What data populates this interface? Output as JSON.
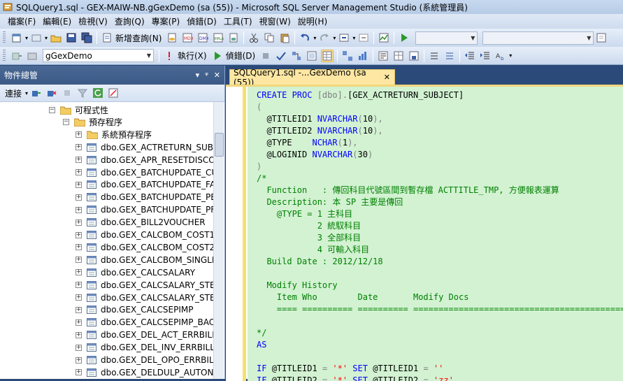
{
  "window": {
    "title": "SQLQuery1.sql - GEX-MAIW-NB.gGexDemo (sa (55)) - Microsoft SQL Server Management Studio (系統管理員)"
  },
  "menu": [
    "檔案(F)",
    "編輯(E)",
    "檢視(V)",
    "查詢(Q)",
    "專案(P)",
    "偵錯(D)",
    "工具(T)",
    "視窗(W)",
    "說明(H)"
  ],
  "toolbar1": {
    "new_query": "新增查詢(N)",
    "combo1": "",
    "combo2": ""
  },
  "toolbar2": {
    "database": "gGexDemo",
    "execute": "執行(X)",
    "debug": "偵錯(D)"
  },
  "object_explorer": {
    "title": "物件總管",
    "connect": "連接",
    "tree": [
      {
        "label": "可程式性",
        "level": 0,
        "state": "expanded",
        "kind": "folder"
      },
      {
        "label": "預存程序",
        "level": 1,
        "state": "expanded",
        "kind": "folder"
      },
      {
        "label": "系統預存程序",
        "level": 2,
        "state": "collapsed",
        "kind": "folder"
      },
      {
        "label": "dbo.GEX_ACTRETURN_SUB.",
        "level": 2,
        "state": "collapsed",
        "kind": "sp"
      },
      {
        "label": "dbo.GEX_APR_RESETDISCO",
        "level": 2,
        "state": "collapsed",
        "kind": "sp"
      },
      {
        "label": "dbo.GEX_BATCHUPDATE_CU",
        "level": 2,
        "state": "collapsed",
        "kind": "sp"
      },
      {
        "label": "dbo.GEX_BATCHUPDATE_FA",
        "level": 2,
        "state": "collapsed",
        "kind": "sp"
      },
      {
        "label": "dbo.GEX_BATCHUPDATE_PE",
        "level": 2,
        "state": "collapsed",
        "kind": "sp"
      },
      {
        "label": "dbo.GEX_BATCHUPDATE_PF",
        "level": 2,
        "state": "collapsed",
        "kind": "sp"
      },
      {
        "label": "dbo.GEX_BILL2VOUCHER",
        "level": 2,
        "state": "collapsed",
        "kind": "sp"
      },
      {
        "label": "dbo.GEX_CALCBOM_COST1",
        "level": 2,
        "state": "collapsed",
        "kind": "sp"
      },
      {
        "label": "dbo.GEX_CALCBOM_COST2",
        "level": 2,
        "state": "collapsed",
        "kind": "sp"
      },
      {
        "label": "dbo.GEX_CALCBOM_SINGLE",
        "level": 2,
        "state": "collapsed",
        "kind": "sp"
      },
      {
        "label": "dbo.GEX_CALCSALARY",
        "level": 2,
        "state": "collapsed",
        "kind": "sp"
      },
      {
        "label": "dbo.GEX_CALCSALARY_STEI",
        "level": 2,
        "state": "collapsed",
        "kind": "sp"
      },
      {
        "label": "dbo.GEX_CALCSALARY_STEI",
        "level": 2,
        "state": "collapsed",
        "kind": "sp"
      },
      {
        "label": "dbo.GEX_CALCSEPIMP",
        "level": 2,
        "state": "collapsed",
        "kind": "sp"
      },
      {
        "label": "dbo.GEX_CALCSEPIMP_BAC",
        "level": 2,
        "state": "collapsed",
        "kind": "sp"
      },
      {
        "label": "dbo.GEX_DEL_ACT_ERRBILL",
        "level": 2,
        "state": "collapsed",
        "kind": "sp"
      },
      {
        "label": "dbo.GEX_DEL_INV_ERRBILL",
        "level": 2,
        "state": "collapsed",
        "kind": "sp"
      },
      {
        "label": "dbo.GEX_DEL_OPO_ERRBILL",
        "level": 2,
        "state": "collapsed",
        "kind": "sp"
      },
      {
        "label": "dbo.GEX_DELDULP_AUTON",
        "level": 2,
        "state": "collapsed",
        "kind": "sp"
      }
    ]
  },
  "editor": {
    "tab_title": "SQLQuery1.sql -...GexDemo (sa (55))",
    "lines": [
      [
        {
          "t": "CREATE PROC ",
          "c": "kw"
        },
        {
          "t": "[dbo]",
          "c": "gy"
        },
        {
          "t": ".",
          "c": "gy"
        },
        {
          "t": "[GEX_ACTRETURN_SUBJECT]",
          "c": ""
        }
      ],
      [
        {
          "t": "(",
          "c": "gy"
        }
      ],
      [
        {
          "t": "  @TITLEID1 ",
          "c": ""
        },
        {
          "t": "NVARCHAR",
          "c": "kw"
        },
        {
          "t": "(",
          "c": "gy"
        },
        {
          "t": "10",
          "c": ""
        },
        {
          "t": "),",
          "c": "gy"
        }
      ],
      [
        {
          "t": "  @TITLEID2 ",
          "c": ""
        },
        {
          "t": "NVARCHAR",
          "c": "kw"
        },
        {
          "t": "(",
          "c": "gy"
        },
        {
          "t": "10",
          "c": ""
        },
        {
          "t": "),",
          "c": "gy"
        }
      ],
      [
        {
          "t": "  @TYPE    ",
          "c": ""
        },
        {
          "t": "NCHAR",
          "c": "kw"
        },
        {
          "t": "(",
          "c": "gy"
        },
        {
          "t": "1",
          "c": ""
        },
        {
          "t": "),",
          "c": "gy"
        }
      ],
      [
        {
          "t": "  @LOGINID ",
          "c": ""
        },
        {
          "t": "NVARCHAR",
          "c": "kw"
        },
        {
          "t": "(",
          "c": "gy"
        },
        {
          "t": "30",
          "c": ""
        },
        {
          "t": ")",
          "c": "gy"
        }
      ],
      [
        {
          "t": ")",
          "c": "gy"
        }
      ],
      [
        {
          "t": "/*",
          "c": "cm"
        }
      ],
      [
        {
          "t": "  Function   : 傳回科目代號區間到暫存檔 ACTTITLE_TMP, 方便報表運算",
          "c": "cm"
        }
      ],
      [
        {
          "t": "  Description: 本 SP 主要是傳回",
          "c": "cm"
        }
      ],
      [
        {
          "t": "    @TYPE = 1 主科目",
          "c": "cm"
        }
      ],
      [
        {
          "t": "            2 統馭科目",
          "c": "cm"
        }
      ],
      [
        {
          "t": "            3 全部科目",
          "c": "cm"
        }
      ],
      [
        {
          "t": "            4 可輸入科目",
          "c": "cm"
        }
      ],
      [
        {
          "t": "  Build Date : 2012/12/18",
          "c": "cm"
        }
      ],
      [
        {
          "t": "",
          "c": "cm"
        }
      ],
      [
        {
          "t": "  Modify History",
          "c": "cm"
        }
      ],
      [
        {
          "t": "    Item Who        Date       Modify Docs",
          "c": "cm"
        }
      ],
      [
        {
          "t": "    ==== ========== ========== ===================================================",
          "c": "cm"
        }
      ],
      [
        {
          "t": "",
          "c": "cm"
        }
      ],
      [
        {
          "t": "*/",
          "c": "cm"
        }
      ],
      [
        {
          "t": "AS",
          "c": "kw"
        }
      ],
      [
        {
          "t": "",
          "c": ""
        }
      ],
      [
        {
          "t": "IF ",
          "c": "kw"
        },
        {
          "t": "@TITLEID1 ",
          "c": ""
        },
        {
          "t": "= ",
          "c": "gy"
        },
        {
          "t": "'*' ",
          "c": "st"
        },
        {
          "t": "SET ",
          "c": "kw"
        },
        {
          "t": "@TITLEID1 ",
          "c": ""
        },
        {
          "t": "= ",
          "c": "gy"
        },
        {
          "t": "''",
          "c": "st"
        }
      ],
      [
        {
          "t": "IF ",
          "c": "kw"
        },
        {
          "t": "@TITLEID2 ",
          "c": ""
        },
        {
          "t": "= ",
          "c": "gy"
        },
        {
          "t": "'*' ",
          "c": "st"
        },
        {
          "t": "SET ",
          "c": "kw"
        },
        {
          "t": "@TITLEID2 ",
          "c": ""
        },
        {
          "t": "= ",
          "c": "gy"
        },
        {
          "t": "'zz'",
          "c": "st"
        }
      ]
    ]
  },
  "colors": {
    "accent": "#2b4a79",
    "tab": "#fde7a3",
    "editor_bg": "#d2f2d2",
    "keyword": "#0000ff",
    "comment": "#008000",
    "string": "#ff0000"
  }
}
